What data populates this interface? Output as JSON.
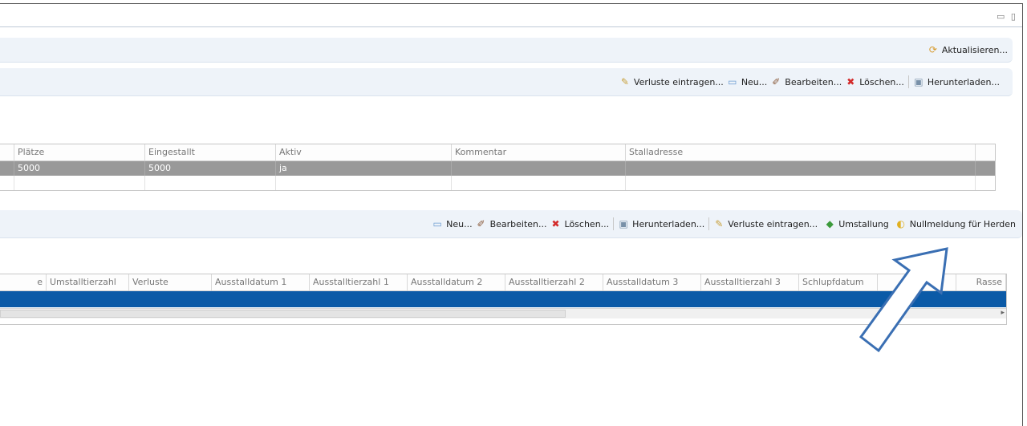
{
  "window": {
    "controls": "▭ ▯"
  },
  "header": {
    "refresh_label": "Aktualisieren..."
  },
  "stall_toolbar": {
    "losses_label": "Verluste eintragen...",
    "new_label": "Neu...",
    "edit_label": "Bearbeiten...",
    "delete_label": "Löschen...",
    "download_label": "Herunterladen..."
  },
  "stall_table": {
    "columns": [
      "Plätze",
      "Eingestallt",
      "Aktiv",
      "Kommentar",
      "Stalladresse"
    ],
    "rows": [
      [
        "5000",
        "5000",
        "ja",
        "",
        ""
      ]
    ]
  },
  "herd_toolbar": {
    "new_label": "Neu...",
    "edit_label": "Bearbeiten...",
    "delete_label": "Löschen...",
    "download_label": "Herunterladen...",
    "losses_label": "Verluste eintragen...",
    "transfer_label": "Umstallung",
    "zero_report_label": "Nullmeldung für Herden"
  },
  "herd_table": {
    "columns": [
      "e",
      "Umstalltierzahl",
      "Verluste",
      "Ausstalldatum 1",
      "Ausstalltierzahl 1",
      "Ausstalldatum 2",
      "Ausstalltierzahl 2",
      "Ausstalldatum 3",
      "Ausstalltierzahl 3",
      "Schlupfdatum",
      "",
      "Rasse"
    ]
  },
  "colors": {
    "header_bg": "#eef3f9",
    "selected_gray": "#999999",
    "selected_blue": "#0b5aa7",
    "arrow_stroke": "#3a6fb3"
  }
}
